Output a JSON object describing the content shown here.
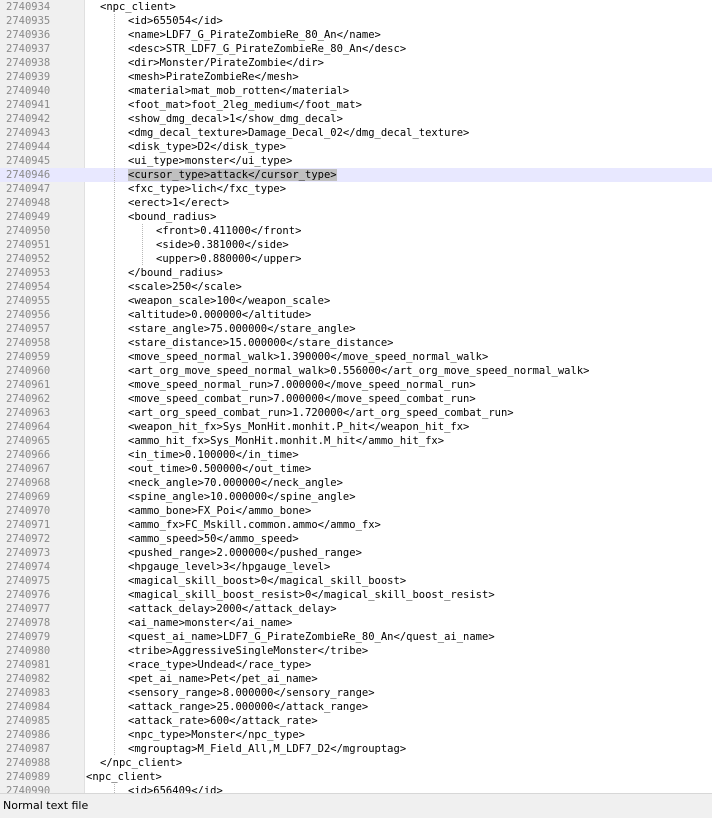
{
  "editor": {
    "current_line": "2740946",
    "lines": [
      {
        "num": "2740934",
        "indent": 1,
        "text": "<npc_client>"
      },
      {
        "num": "2740935",
        "indent": 2,
        "text": "<id>655054</id>"
      },
      {
        "num": "2740936",
        "indent": 2,
        "text": "<name>LDF7_G_PirateZombieRe_80_An</name>"
      },
      {
        "num": "2740937",
        "indent": 2,
        "text": "<desc>STR_LDF7_G_PirateZombieRe_80_An</desc>"
      },
      {
        "num": "2740938",
        "indent": 2,
        "text": "<dir>Monster/PirateZombie</dir>"
      },
      {
        "num": "2740939",
        "indent": 2,
        "text": "<mesh>PirateZombieRe</mesh>"
      },
      {
        "num": "2740940",
        "indent": 2,
        "text": "<material>mat_mob_rotten</material>"
      },
      {
        "num": "2740941",
        "indent": 2,
        "text": "<foot_mat>foot_2leg_medium</foot_mat>"
      },
      {
        "num": "2740942",
        "indent": 2,
        "text": "<show_dmg_decal>1</show_dmg_decal>"
      },
      {
        "num": "2740943",
        "indent": 2,
        "text": "<dmg_decal_texture>Damage_Decal_02</dmg_decal_texture>"
      },
      {
        "num": "2740944",
        "indent": 2,
        "text": "<disk_type>D2</disk_type>"
      },
      {
        "num": "2740945",
        "indent": 2,
        "text": "<ui_type>monster</ui_type>"
      },
      {
        "num": "2740946",
        "indent": 2,
        "text": "<cursor_type>attack</cursor_type>",
        "selected": true
      },
      {
        "num": "2740947",
        "indent": 2,
        "text": "<fxc_type>lich</fxc_type>"
      },
      {
        "num": "2740948",
        "indent": 2,
        "text": "<erect>1</erect>"
      },
      {
        "num": "2740949",
        "indent": 2,
        "text": "<bound_radius>"
      },
      {
        "num": "2740950",
        "indent": 3,
        "text": "<front>0.411000</front>"
      },
      {
        "num": "2740951",
        "indent": 3,
        "text": "<side>0.381000</side>"
      },
      {
        "num": "2740952",
        "indent": 3,
        "text": "<upper>0.880000</upper>"
      },
      {
        "num": "2740953",
        "indent": 2,
        "text": "</bound_radius>"
      },
      {
        "num": "2740954",
        "indent": 2,
        "text": "<scale>250</scale>"
      },
      {
        "num": "2740955",
        "indent": 2,
        "text": "<weapon_scale>100</weapon_scale>"
      },
      {
        "num": "2740956",
        "indent": 2,
        "text": "<altitude>0.000000</altitude>"
      },
      {
        "num": "2740957",
        "indent": 2,
        "text": "<stare_angle>75.000000</stare_angle>"
      },
      {
        "num": "2740958",
        "indent": 2,
        "text": "<stare_distance>15.000000</stare_distance>"
      },
      {
        "num": "2740959",
        "indent": 2,
        "text": "<move_speed_normal_walk>1.390000</move_speed_normal_walk>"
      },
      {
        "num": "2740960",
        "indent": 2,
        "text": "<art_org_move_speed_normal_walk>0.556000</art_org_move_speed_normal_walk>"
      },
      {
        "num": "2740961",
        "indent": 2,
        "text": "<move_speed_normal_run>7.000000</move_speed_normal_run>"
      },
      {
        "num": "2740962",
        "indent": 2,
        "text": "<move_speed_combat_run>7.000000</move_speed_combat_run>"
      },
      {
        "num": "2740963",
        "indent": 2,
        "text": "<art_org_speed_combat_run>1.720000</art_org_speed_combat_run>"
      },
      {
        "num": "2740964",
        "indent": 2,
        "text": "<weapon_hit_fx>Sys_MonHit.monhit.P_hit</weapon_hit_fx>"
      },
      {
        "num": "2740965",
        "indent": 2,
        "text": "<ammo_hit_fx>Sys_MonHit.monhit.M_hit</ammo_hit_fx>"
      },
      {
        "num": "2740966",
        "indent": 2,
        "text": "<in_time>0.100000</in_time>"
      },
      {
        "num": "2740967",
        "indent": 2,
        "text": "<out_time>0.500000</out_time>"
      },
      {
        "num": "2740968",
        "indent": 2,
        "text": "<neck_angle>70.000000</neck_angle>"
      },
      {
        "num": "2740969",
        "indent": 2,
        "text": "<spine_angle>10.000000</spine_angle>"
      },
      {
        "num": "2740970",
        "indent": 2,
        "text": "<ammo_bone>FX_Poi</ammo_bone>"
      },
      {
        "num": "2740971",
        "indent": 2,
        "text": "<ammo_fx>FC_Mskill.common.ammo</ammo_fx>"
      },
      {
        "num": "2740972",
        "indent": 2,
        "text": "<ammo_speed>50</ammo_speed>"
      },
      {
        "num": "2740973",
        "indent": 2,
        "text": "<pushed_range>2.000000</pushed_range>"
      },
      {
        "num": "2740974",
        "indent": 2,
        "text": "<hpgauge_level>3</hpgauge_level>"
      },
      {
        "num": "2740975",
        "indent": 2,
        "text": "<magical_skill_boost>0</magical_skill_boost>"
      },
      {
        "num": "2740976",
        "indent": 2,
        "text": "<magical_skill_boost_resist>0</magical_skill_boost_resist>"
      },
      {
        "num": "2740977",
        "indent": 2,
        "text": "<attack_delay>2000</attack_delay>"
      },
      {
        "num": "2740978",
        "indent": 2,
        "text": "<ai_name>monster</ai_name>"
      },
      {
        "num": "2740979",
        "indent": 2,
        "text": "<quest_ai_name>LDF7_G_PirateZombieRe_80_An</quest_ai_name>"
      },
      {
        "num": "2740980",
        "indent": 2,
        "text": "<tribe>AggressiveSingleMonster</tribe>"
      },
      {
        "num": "2740981",
        "indent": 2,
        "text": "<race_type>Undead</race_type>"
      },
      {
        "num": "2740982",
        "indent": 2,
        "text": "<pet_ai_name>Pet</pet_ai_name>"
      },
      {
        "num": "2740983",
        "indent": 2,
        "text": "<sensory_range>8.000000</sensory_range>"
      },
      {
        "num": "2740984",
        "indent": 2,
        "text": "<attack_range>25.000000</attack_range>"
      },
      {
        "num": "2740985",
        "indent": 2,
        "text": "<attack_rate>600</attack_rate>"
      },
      {
        "num": "2740986",
        "indent": 2,
        "text": "<npc_type>Monster</npc_type>"
      },
      {
        "num": "2740987",
        "indent": 2,
        "text": "<mgrouptag>M_Field_All,M_LDF7_D2</mgrouptag>"
      },
      {
        "num": "2740988",
        "indent": 1,
        "text": "</npc_client>"
      },
      {
        "num": "2740989",
        "indent": 0,
        "text": "<npc_client>"
      },
      {
        "num": "2740990",
        "indent": 2,
        "text": "<id>656409</id>"
      }
    ]
  },
  "statusbar": {
    "file_type": "Normal text file"
  }
}
